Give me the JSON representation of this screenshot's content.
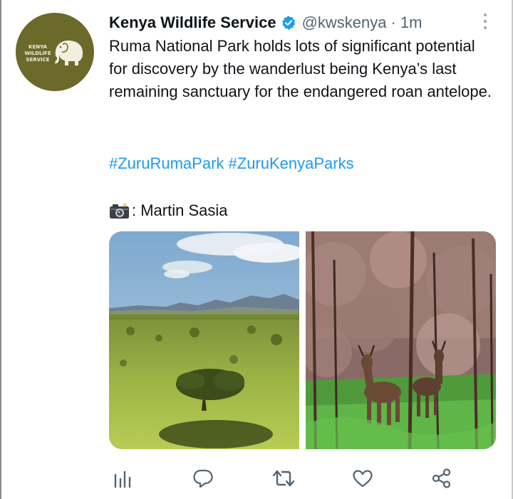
{
  "tweet": {
    "avatar": {
      "logo_lines": [
        "KENYA",
        "WILDLIFE",
        "SERVICE"
      ],
      "background": "#6b6a2b",
      "icon": "elephant-icon"
    },
    "display_name": "Kenya Wildlife Service",
    "verified_icon": "verified-badge-icon",
    "handle": "@kwskenya",
    "separator": "·",
    "timestamp": "1m",
    "more_icon": "more-options-icon",
    "text": "Ruma National Park holds lots of significant potential for discovery by the wanderlust being Kenya’s last remaining sanctuary for the endangered roan antelope.",
    "hashtags": [
      "#ZuruRumaPark",
      "#ZuruKenyaParks"
    ],
    "credit": {
      "icon": "camera-flash-icon",
      "text": ": Martin Sasia"
    },
    "media": [
      {
        "icon": "savanna-landscape-photo"
      },
      {
        "icon": "roan-antelope-photo"
      }
    ],
    "actions": [
      {
        "name": "analytics",
        "icon": "analytics-icon"
      },
      {
        "name": "reply",
        "icon": "reply-icon"
      },
      {
        "name": "retweet",
        "icon": "retweet-icon"
      },
      {
        "name": "like",
        "icon": "heart-icon"
      },
      {
        "name": "share",
        "icon": "share-icon"
      }
    ],
    "colors": {
      "accent": "#1d9bf0",
      "secondary_text": "#536471",
      "action_icons": "#536471"
    }
  }
}
